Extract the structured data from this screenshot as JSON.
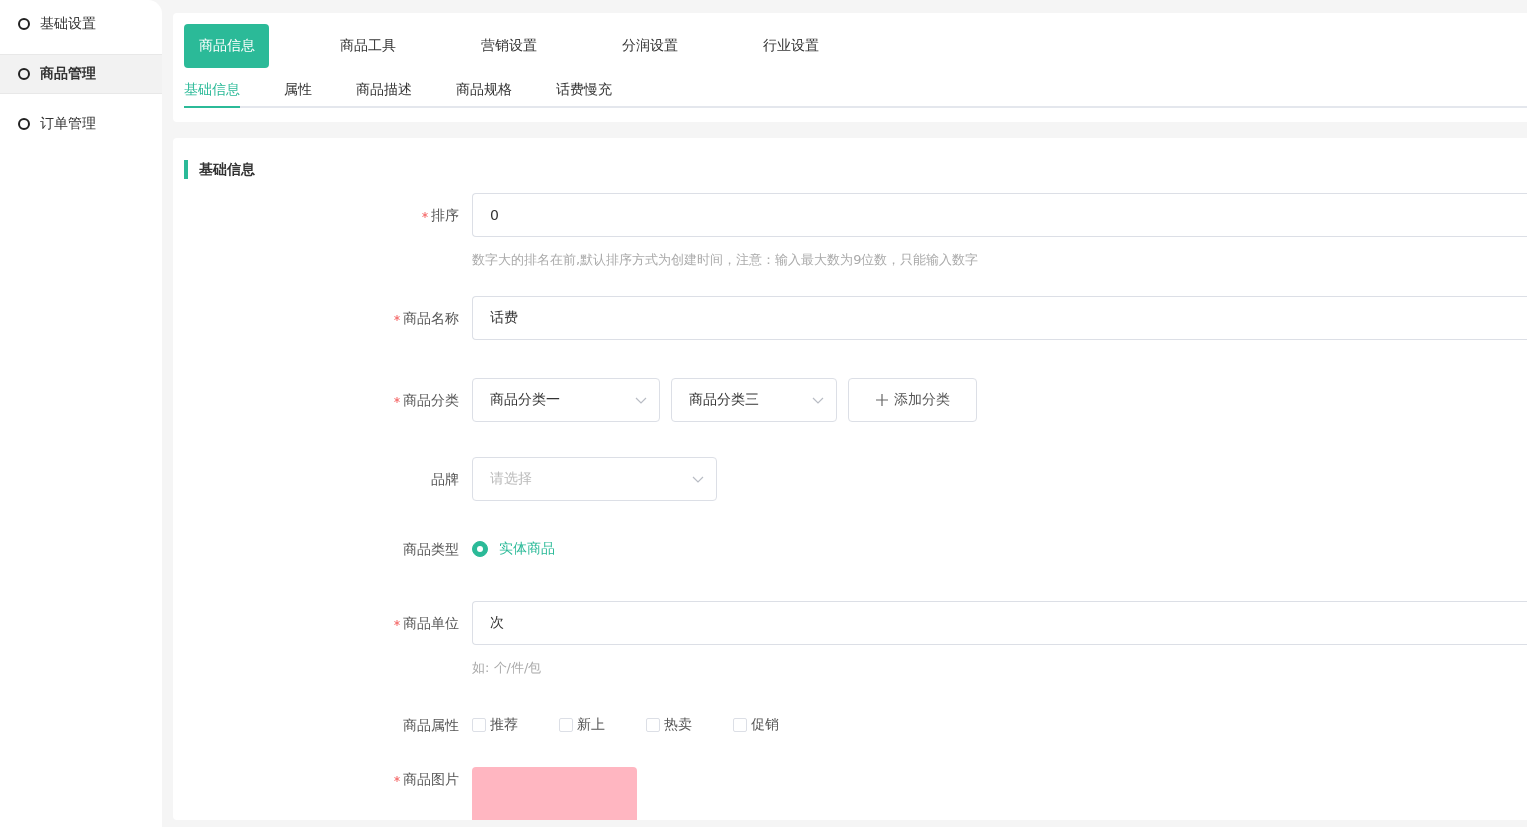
{
  "sidebar": {
    "items": [
      {
        "label": "基础设置",
        "selected": false
      },
      {
        "label": "商品管理",
        "selected": true
      },
      {
        "label": "订单管理",
        "selected": false
      }
    ]
  },
  "main_tabs": [
    {
      "label": "商品信息",
      "selected": true
    },
    {
      "label": "商品工具",
      "selected": false
    },
    {
      "label": "营销设置",
      "selected": false
    },
    {
      "label": "分润设置",
      "selected": false
    },
    {
      "label": "行业设置",
      "selected": false
    }
  ],
  "sub_tabs": [
    {
      "label": "基础信息",
      "selected": true
    },
    {
      "label": "属性",
      "selected": false
    },
    {
      "label": "商品描述",
      "selected": false
    },
    {
      "label": "商品规格",
      "selected": false
    },
    {
      "label": "话费慢充",
      "selected": false
    }
  ],
  "section_title": "基础信息",
  "fields": [
    {
      "kind": "input",
      "label": "排序",
      "required": true,
      "value": "0",
      "hint": "数字大的排名在前,默认排序方式为创建时间，注意：输入最大数为9位数，只能输入数字"
    },
    {
      "kind": "input",
      "label": "商品名称",
      "required": true,
      "value": "话费"
    },
    {
      "kind": "category",
      "label": "商品分类",
      "required": true,
      "selects": [
        "商品分类一",
        "商品分类三"
      ],
      "add_button": "添加分类"
    },
    {
      "kind": "select",
      "label": "品牌",
      "required": false,
      "placeholder": "请选择"
    },
    {
      "kind": "radio",
      "label": "商品类型",
      "required": false,
      "options": [
        {
          "label": "实体商品",
          "selected": true
        }
      ]
    },
    {
      "kind": "input",
      "label": "商品单位",
      "required": true,
      "value": "次",
      "hint": "如: 个/件/包"
    },
    {
      "kind": "checkboxes",
      "label": "商品属性",
      "required": false,
      "options": [
        {
          "label": "推荐",
          "checked": false
        },
        {
          "label": "新上",
          "checked": false
        },
        {
          "label": "热卖",
          "checked": false
        },
        {
          "label": "促销",
          "checked": false
        }
      ]
    },
    {
      "kind": "image",
      "label": "商品图片",
      "required": true
    }
  ]
}
